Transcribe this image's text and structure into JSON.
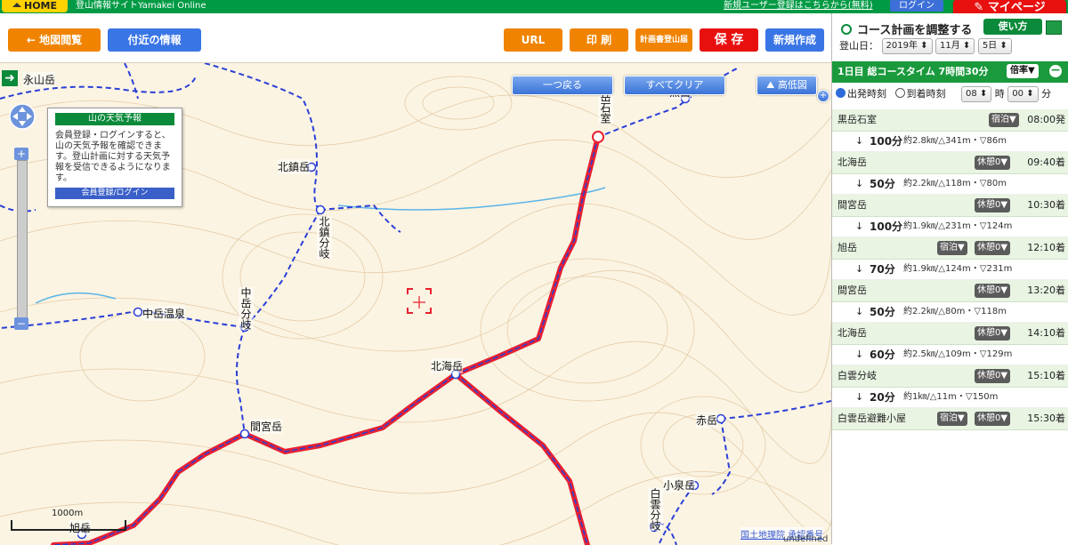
{
  "topbar": {
    "home": "HOME",
    "site_title": "登山情報サイトYamakei Online",
    "register": "新規ユーザー登録はこちらから(無料)",
    "login": "ログイン",
    "mypage": "マイページ"
  },
  "toolbar": {
    "map_view": "← 地図閲覧",
    "nearby": "付近の情報",
    "url": "URL",
    "print": "印 刷",
    "plan_form": "計画書登山届",
    "save": "保 存",
    "new": "新規作成"
  },
  "map": {
    "back": "一つ戻る",
    "clear_all": "すべてクリア",
    "elevation": "高低図",
    "weather": {
      "title": "山の天気予報",
      "body": "会員登録・ログインすると、山の天気予報を確認できます。登山計画に対する天気予報を受信できるようになります。",
      "button": "会員登録/ログイン"
    },
    "labels": {
      "eizan": "永山岳",
      "kitachin": "北鎮岳",
      "kitachin_bunki": "北鎮分岐",
      "nakadake_bunki": "中岳分岐",
      "nakadake_onsen": "中岳温泉",
      "hokkai": "北海岳",
      "mamiya": "間宮岳",
      "akadake": "赤岳",
      "koizumi": "小泉岳",
      "hakuun_bunki": "白雲分岐",
      "kurodake_ishimuro": "黒岳石室",
      "kurodake": "黒岳",
      "asahidake": "旭岳"
    },
    "scale": "1000m",
    "credits": "国土地理院 承認番号",
    "undefined_text": "undefined"
  },
  "panel": {
    "title": "コース計画を調整する",
    "howto": "使い方",
    "date_label": "登山日：",
    "year": "2019年",
    "month": "11月",
    "day": "5日",
    "summary": "1日目  総コースタイム  7時間30分",
    "rate": "倍率▼",
    "depart": "出発時刻",
    "arrive": "到着時刻",
    "hour": "08",
    "hour_unit": "時",
    "minute": "00",
    "minute_unit": "分",
    "stops": [
      {
        "name": "黒岳石室",
        "tag1": "宿泊▼",
        "tag2": "",
        "time": "08:00発"
      },
      {
        "name": "北海岳",
        "tag1": "",
        "tag2": "休憩0▼",
        "time": "09:40着"
      },
      {
        "name": "間宮岳",
        "tag1": "",
        "tag2": "休憩0▼",
        "time": "10:30着"
      },
      {
        "name": "旭岳",
        "tag1": "宿泊▼",
        "tag2": "休憩0▼",
        "time": "12:10着"
      },
      {
        "name": "間宮岳",
        "tag1": "",
        "tag2": "休憩0▼",
        "time": "13:20着"
      },
      {
        "name": "北海岳",
        "tag1": "",
        "tag2": "休憩0▼",
        "time": "14:10着"
      },
      {
        "name": "白雲分岐",
        "tag1": "",
        "tag2": "休憩0▼",
        "time": "15:10着"
      },
      {
        "name": "白雲岳避難小屋",
        "tag1": "宿泊▼",
        "tag2": "休憩0▼",
        "time": "15:30着"
      }
    ],
    "segments": [
      {
        "arrow": "↓",
        "dur": "100分",
        "det": "約2.8㎞/△341m・▽86m"
      },
      {
        "arrow": "↓",
        "dur": "50分",
        "det": "約2.2㎞/△118m・▽80m"
      },
      {
        "arrow": "↓",
        "dur": "100分",
        "det": "約1.9㎞/△231m・▽124m"
      },
      {
        "arrow": "↓",
        "dur": "70分",
        "det": "約1.9㎞/△124m・▽231m"
      },
      {
        "arrow": "↓",
        "dur": "50分",
        "det": "約2.2㎞/△80m・▽118m"
      },
      {
        "arrow": "↓",
        "dur": "60分",
        "det": "約2.5㎞/△109m・▽129m"
      },
      {
        "arrow": "↓",
        "dur": "20分",
        "det": "約1㎞/△11m・▽150m"
      }
    ]
  }
}
